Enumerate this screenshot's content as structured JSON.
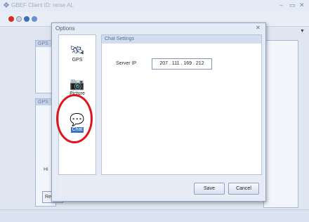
{
  "window": {
    "title": "GBEF Client ID: rerse AL",
    "controls": [
      "–",
      "▭",
      "✕"
    ]
  },
  "background_panels": {
    "panel_a_head": "GPS",
    "panel_b_head": "GPS",
    "panel_b_fragments": [
      "Hi"
    ],
    "left_button": "Re"
  },
  "dialog": {
    "title": "Options",
    "close": "✕",
    "categories": [
      {
        "label": "GPS",
        "icon": "gps-icon",
        "selected": false
      },
      {
        "label": "Picture",
        "icon": "camera-icon",
        "selected": false
      },
      {
        "label": "Chat",
        "icon": "chat-icon",
        "selected": true
      }
    ],
    "section_title": "Chat Settings",
    "server_ip_label": "Server IP",
    "server_ip_value": "207 . 111 . 169 . 212",
    "save_label": "Save",
    "cancel_label": "Cancel"
  },
  "colors": {
    "accent": "#3574c9",
    "highlight": "#e0141b"
  }
}
